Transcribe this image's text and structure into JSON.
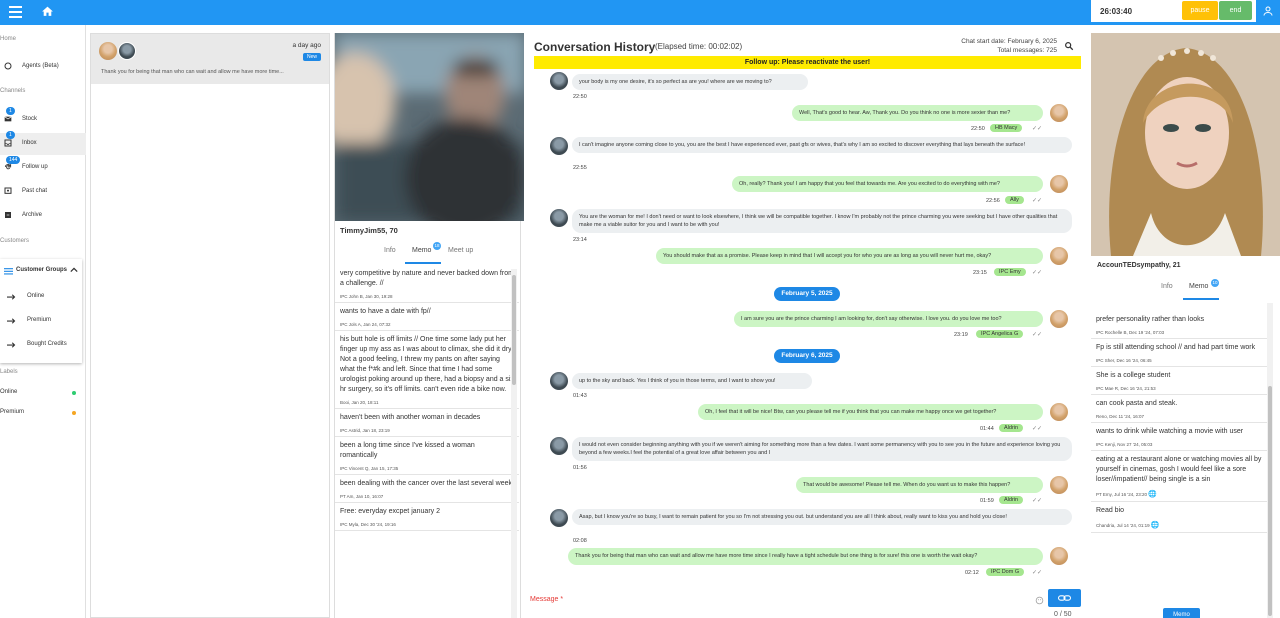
{
  "topbar": {
    "timer": "26:03:40",
    "pause_label": "pause",
    "end_label": "end"
  },
  "sidebar": {
    "home_label": "Home",
    "agents_label": "Agents (Beta)",
    "channels_label": "Channels",
    "items": [
      {
        "label": "Stock",
        "badge": "1"
      },
      {
        "label": "Inbox",
        "badge": "1"
      },
      {
        "label": "Follow up",
        "badge": "144"
      },
      {
        "label": "Past chat"
      },
      {
        "label": "Archive"
      }
    ],
    "customers_label": "Customers",
    "customer_groups_label": "Customer Groups",
    "groups": [
      "Online",
      "Premium",
      "Bought Credits"
    ],
    "labels_label": "Labels",
    "labels": [
      {
        "name": "Online",
        "color": "#2ecc71"
      },
      {
        "name": "Premium",
        "color": "#f5a623"
      }
    ]
  },
  "inbox": {
    "time": "a day ago",
    "badge": "New",
    "preview": "Thank you for being that man who can wait and allow me have more time..."
  },
  "profile": {
    "name": "TimmyJim55, 70",
    "tabs": [
      "Info",
      "Memo",
      "Meet up"
    ],
    "memo_badge": "18",
    "memos": [
      {
        "text": "very competitive by nature and never backed down from a challenge. //",
        "meta": "IPC John B, Jan 30, 19:28"
      },
      {
        "text": "wants to have a date with fp//",
        "meta": "IPC Jols A, Jan 24, 07:32"
      },
      {
        "text": "his butt hole is off limits //  One time some lady put her finger up my ass as I was about to climax, she did it dry! Not a good feeling, I threw my pants on after saying what the f*#k and left. Since that time I had some urologist poking around up there, had a biopsy and a six hr surgery, so it's off limits. can't even ride a bike now.",
        "meta": "Booi, Jan 20, 18:11"
      },
      {
        "text": "haven't been with another woman in decades",
        "meta": "IPC Astrid, Jan 18, 23:19"
      },
      {
        "text": "been a long time since I've kissed a woman romantically",
        "meta": "IPC Vincent Q, Jan 15, 17:35"
      },
      {
        "text": "been dealing with the cancer over the last several week",
        "meta": "PT Am, Jan 10, 16:07"
      },
      {
        "text": "Free: everyday excpet january 2",
        "meta": "IPC Myla, Dec 30 '24, 19:16"
      }
    ]
  },
  "conversation": {
    "title": "Conversation History",
    "elapsed": "(Elapsed time: 00:02:02)",
    "start_date": "Chat start date: February 6, 2025",
    "total_messages": "Total messages: 725",
    "followup_banner": "Follow up: Please reactivate the user!",
    "dates": [
      "February 5, 2025",
      "February 6, 2025"
    ],
    "messages": [
      {
        "dir": "in",
        "text": "your body is my one desire, it's so perfect as are you! where are we moving to?",
        "time": "22:50"
      },
      {
        "dir": "out",
        "text": "Well, That's good to hear. Aw, Thank you. Do you think no one is more sexier than me?",
        "time": "22:50",
        "agent": "HB Macy"
      },
      {
        "dir": "in",
        "text": "I can't imagine anyone coming close to you, you are the best I have experienced ever, past gfs or wives, that's why I am so excited to discover everything that lays beneath the surface!",
        "time": "22:55"
      },
      {
        "dir": "out",
        "text": "Oh, really? Thank you! I am happy that you feel that towards me. Are you excited to do everything with me?",
        "time": "22:56",
        "agent": "Ally"
      },
      {
        "dir": "in",
        "text": "You are the woman for me! I don't need or want to look elsewhere, I think we will be compatible together. I know I'm probably not the prince charming you were seeking but I have other qualities that make me a viable suitor for you and I want to be with you!",
        "time": "23:14"
      },
      {
        "dir": "out",
        "text": "You should make that as a promise. Please keep in mind that I will accept you for who you are as long as you will never hurt me, okay?",
        "time": "23:15",
        "agent": "IPC Emy"
      },
      {
        "dir": "out",
        "text": "I am sure you are the prince charming I am looking for, don't say otherwise. I love you. do you love me too?",
        "time": "23:19",
        "agent": "IPC Angelica G"
      },
      {
        "dir": "in",
        "text": "up to the sky and back. Yes I think of you in those terms, and I want to show you!",
        "time": "01:43"
      },
      {
        "dir": "out",
        "text": "Oh, I feel that it will be nice! Btw, can you please tell me if you think that you can make me happy once we get together?",
        "time": "01:44",
        "agent": "Aldrin"
      },
      {
        "dir": "in",
        "text": "I would not even consider beginning anything with you if we weren't aiming for something more than a few dates. I want some permanency with you to see you in the future and experience loving you beyond a few weeks.I feel the potential of a great love affair between you and I",
        "time": "01:56"
      },
      {
        "dir": "out",
        "text": "That would be awesome! Please tell me. When do you want us to make this happen?",
        "time": "01:59",
        "agent": "Aldrin"
      },
      {
        "dir": "in",
        "text": "Asap, but I know you're so busy, I want to remain patient for you so I'm not stressing you out. but understand you are all I think about,  really want to kiss you and hold you close!",
        "time": "02:08"
      },
      {
        "dir": "out",
        "text": "Thank you for being that man who can wait and allow me have more time since I really have a tight schedule but one thing is for sure! this one is worth the wait okay?",
        "time": "02:12",
        "agent": "IPC Dom G"
      }
    ],
    "input_label": "Message *",
    "counter": "0 / 50"
  },
  "agent_profile": {
    "name": "AccounTEDsympathy, 21",
    "tabs": [
      "Info",
      "Memo"
    ],
    "memo_badge": "10",
    "memos": [
      {
        "text": "prefer personality rather than looks",
        "meta": "IPC Rochelle B, Dec 19 '24, 07:03"
      },
      {
        "text": "Fp is still attending school // and had part time work",
        "meta": "IPC Sher, Dec 16 '24, 06:45"
      },
      {
        "text": "She is a college student",
        "meta": "IPC Mae R, Dec 16 '24, 21:53"
      },
      {
        "text": "can cook pasta and steak.",
        "meta": "Reno, Dec 11 '24, 16:07"
      },
      {
        "text": "wants to drink while watching a movie with user",
        "meta": "IPC Kenji, Nov 27 '24, 05:03"
      },
      {
        "text": "eating at a restaurant alone or watching movies all by yourself in cinemas, gosh I would feel like a sore loser//impatient// being single is a sin",
        "meta": "PT Emy, Jul 16 '24, 23:20"
      },
      {
        "text": "Read bio",
        "meta": "Chandria, Jul 14 '24, 01:19"
      }
    ],
    "memo_button": "Memo"
  }
}
